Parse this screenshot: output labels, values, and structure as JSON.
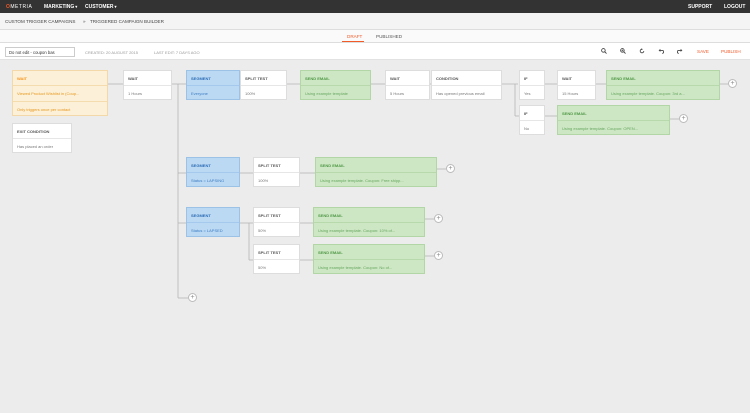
{
  "topbar": {
    "logo_brand": "METRIA",
    "nav_marketing": "MARKETING",
    "nav_customer": "CUSTOMER",
    "support": "SUPPORT",
    "logout": "LOGOUT"
  },
  "breadcrumb": {
    "parent": "CUSTOM TRIGGER CAMPAIGNS",
    "separator": "»",
    "current": "TRIGGERED CAMPAIGN BUILDER"
  },
  "tabs": {
    "draft": "DRAFT",
    "published": "PUBLISHED"
  },
  "toolbar": {
    "campaign_name": "Do not edit - coupon bas",
    "created": "CREATED: 20 AUGUST 2015",
    "last_edit": "LAST EDIT: 7 DAYS AGO",
    "save": "SAVE",
    "publish": "PUBLISH"
  },
  "nodes": {
    "wait_trigger": {
      "title": "WAIT",
      "line1": "Viewed Product Wishlist in (Coup...",
      "line2": "Only triggers once per contact"
    },
    "exit_condition": {
      "title": "EXIT CONDITION",
      "body": "Has placed an order"
    },
    "wait1": {
      "title": "WAIT",
      "body": "1 Hours"
    },
    "segment1": {
      "title": "SEGMENT",
      "body": "Everyone"
    },
    "split1": {
      "title": "SPLIT TEST",
      "body": "100%"
    },
    "send1": {
      "title": "SEND EMAIL",
      "body": "Using example template"
    },
    "wait2": {
      "title": "WAIT",
      "body": "5 Hours"
    },
    "condition1": {
      "title": "CONDITION",
      "body": "Has opened previous email"
    },
    "if_yes": {
      "title": "IF",
      "body": "Yes"
    },
    "wait3": {
      "title": "WAIT",
      "body": "15 Hours"
    },
    "send2": {
      "title": "SEND EMAIL",
      "body": "Using example template. Coupon: 3rd a..."
    },
    "if_no": {
      "title": "IF",
      "body": "No"
    },
    "send3": {
      "title": "SEND EMAIL",
      "body": "Using example template. Coupon: OPEN..."
    },
    "segment2": {
      "title": "SEGMENT",
      "body": "Status = LAPSING"
    },
    "split2": {
      "title": "SPLIT TEST",
      "body": "100%"
    },
    "send4": {
      "title": "SEND EMAIL",
      "body": "Using example template. Coupon: Free shipp..."
    },
    "segment3": {
      "title": "SEGMENT",
      "body": "Status = LAPSED"
    },
    "split3": {
      "title": "SPLIT TEST",
      "body": "50%"
    },
    "send5": {
      "title": "SEND EMAIL",
      "body": "Using example template. Coupon: 10% of..."
    },
    "split4": {
      "title": "SPLIT TEST",
      "body": "50%"
    },
    "send6": {
      "title": "SEND EMAIL",
      "body": "Using example template. Coupon: No of..."
    }
  },
  "plus_symbol": "+",
  "colors": {
    "accent": "#f15a29",
    "segment": "#bcd9f3",
    "email": "#cde6c4",
    "trigger": "#fdf0d8"
  }
}
